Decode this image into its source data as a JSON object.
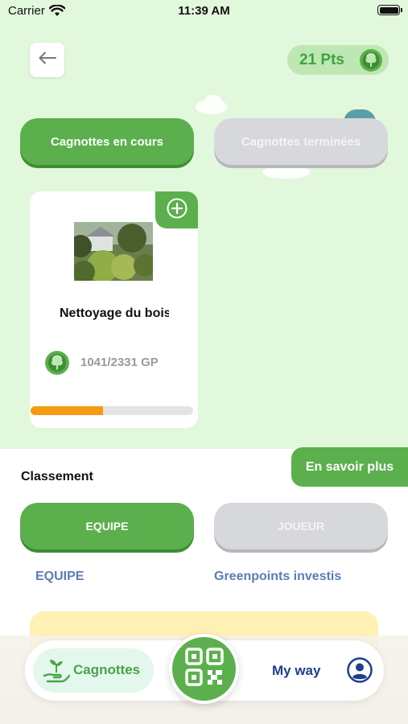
{
  "status_bar": {
    "carrier": "Carrier",
    "time": "11:39 AM"
  },
  "header": {
    "points": "21 Pts"
  },
  "tabs": {
    "active": "Cagnottes en cours",
    "inactive": "Cagnottes terminées"
  },
  "cards": [
    {
      "title": "Nettoyage du bois",
      "progress_text": "1041/2331 GP",
      "progress_fraction": 0.447
    }
  ],
  "ranking": {
    "learn_more": "En savoir plus",
    "title": "Classement",
    "toggle_active": "EQUIPE",
    "toggle_inactive": "JOUEUR",
    "col_team": "EQUIPE",
    "col_points": "Greenpoints investis"
  },
  "nav": {
    "tab_cagnottes": "Cagnottes",
    "tab_myway": "My way"
  },
  "colors": {
    "primary_green": "#5bb04d",
    "progress": "#f59b13",
    "background": "#e2f8dc",
    "nav_text": "#1e3f8c"
  }
}
